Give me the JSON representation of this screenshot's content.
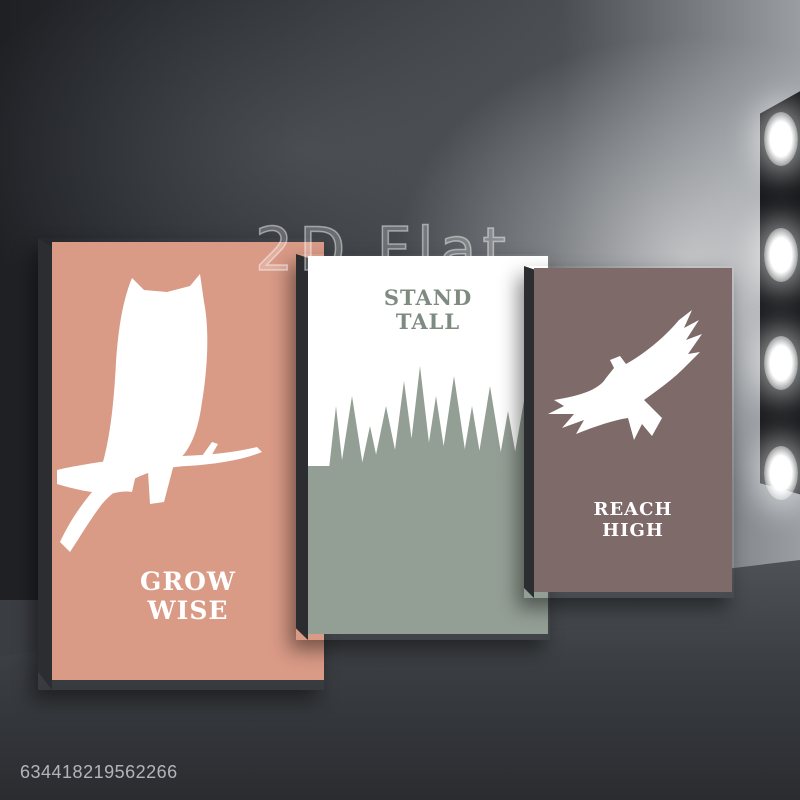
{
  "image_id": "634418219562266",
  "watermark": "2D Flat",
  "posters": [
    {
      "title_line1": "GROW",
      "title_line2": "WISE",
      "color": "#d99a86",
      "icon": "owl-icon"
    },
    {
      "title_line1": "STAND",
      "title_line2": "TALL",
      "color": "#939e94",
      "icon": "forest-icon"
    },
    {
      "title_line1": "REACH",
      "title_line2": "HIGH",
      "color": "#7e6a69",
      "icon": "eagle-icon"
    }
  ]
}
